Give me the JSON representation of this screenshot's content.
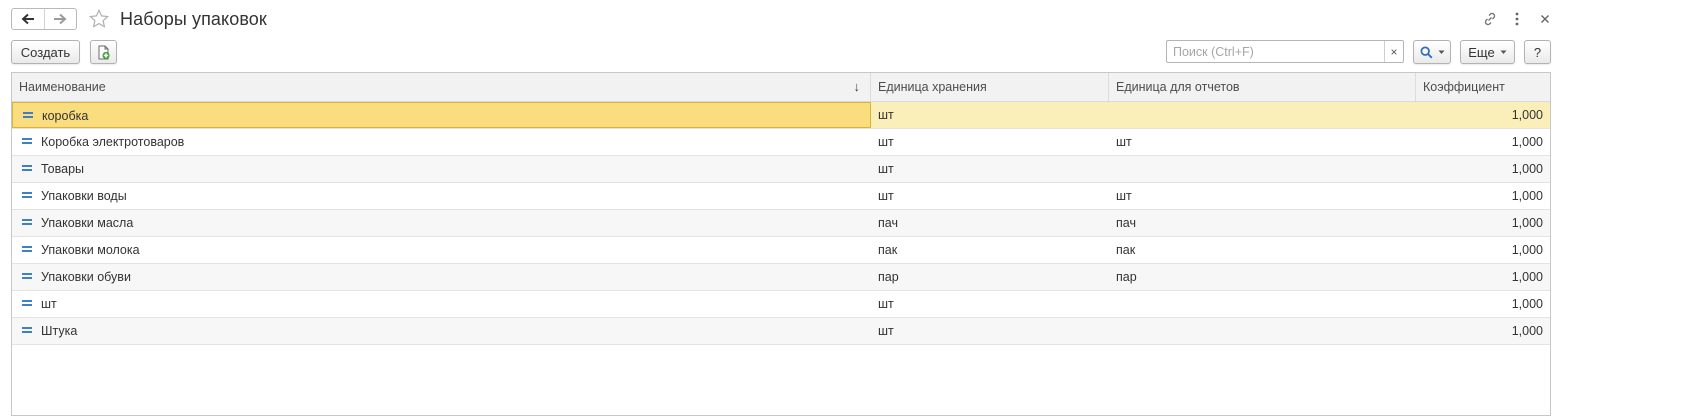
{
  "window": {
    "title": "Наборы упаковок",
    "icons": {
      "back": "arrow-left-icon",
      "forward": "arrow-right-icon",
      "favorite": "star-icon",
      "link": "link-icon",
      "more": "more-vertical-icon",
      "close": "close-icon"
    }
  },
  "toolbar": {
    "create_label": "Создать",
    "copy_icon": "create-copy-icon",
    "search_placeholder": "Поиск (Ctrl+F)",
    "search_value": "",
    "search_clear": "×",
    "search_button_icon": "search-icon",
    "more_label": "Еще",
    "help_label": "?"
  },
  "table": {
    "columns": [
      {
        "label": "Наименование",
        "sort": "↓"
      },
      {
        "label": "Единица хранения"
      },
      {
        "label": "Единица для отчетов"
      },
      {
        "label": "Коэффициент"
      }
    ],
    "rows": [
      {
        "name": "коробка",
        "storage_unit": "шт",
        "report_unit": "",
        "coefficient": "1,000",
        "selected": true
      },
      {
        "name": "Коробка электротоваров",
        "storage_unit": "шт",
        "report_unit": "шт",
        "coefficient": "1,000"
      },
      {
        "name": "Товары",
        "storage_unit": "шт",
        "report_unit": "",
        "coefficient": "1,000"
      },
      {
        "name": "Упаковки воды",
        "storage_unit": "шт",
        "report_unit": "шт",
        "coefficient": "1,000"
      },
      {
        "name": "Упаковки масла",
        "storage_unit": "пач",
        "report_unit": "пач",
        "coefficient": "1,000"
      },
      {
        "name": "Упаковки молока",
        "storage_unit": "пак",
        "report_unit": "пак",
        "coefficient": "1,000"
      },
      {
        "name": "Упаковки обуви",
        "storage_unit": "пар",
        "report_unit": "пар",
        "coefficient": "1,000"
      },
      {
        "name": "шт",
        "storage_unit": "шт",
        "report_unit": "",
        "coefficient": "1,000"
      },
      {
        "name": "Штука",
        "storage_unit": "шт",
        "report_unit": "",
        "coefficient": "1,000"
      }
    ],
    "row_icon": "list-item-icon"
  },
  "colors": {
    "selected_row": "#fbefb9",
    "selected_cell": "#f9dd7e",
    "accent_blue": "#3f7fc4"
  }
}
